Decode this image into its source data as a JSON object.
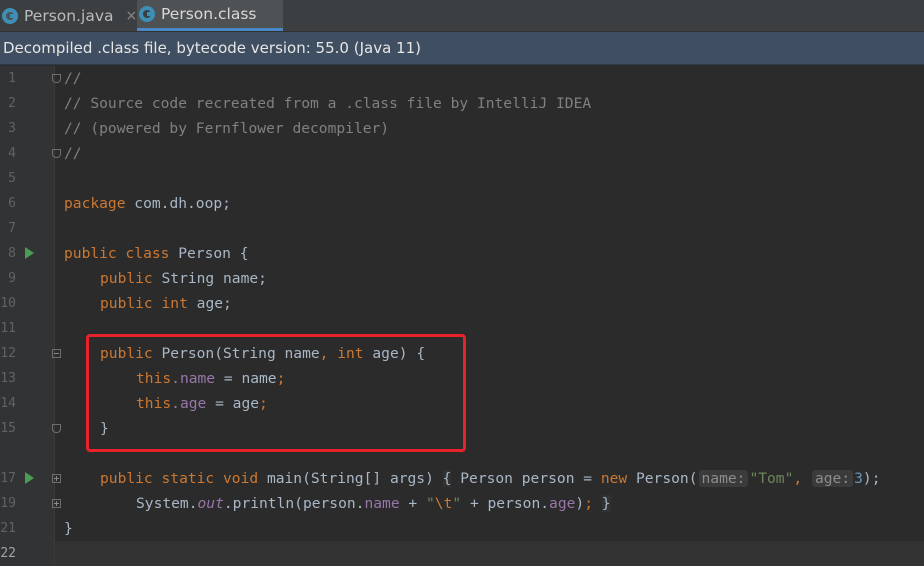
{
  "tabs": [
    {
      "label": "Person.java",
      "close": "×"
    },
    {
      "label": "Person.class"
    }
  ],
  "banner": "Decompiled .class file, bytecode version: 55.0 (Java 11)",
  "line_numbers": [
    "1",
    "2",
    "3",
    "4",
    "5",
    "6",
    "7",
    "8",
    "9",
    "10",
    "11",
    "12",
    "13",
    "14",
    "15",
    "17",
    "19",
    "21",
    "22"
  ],
  "code": {
    "l1": "//",
    "l2": "// Source code recreated from a .class file by IntelliJ IDEA",
    "l3": "// (powered by Fernflower decompiler)",
    "l4": "//",
    "l6_kw": "package",
    "l6_rest": " com.dh.oop;",
    "l8_kw": "public class",
    "l8_rest": " Person {",
    "l9_kw": "public",
    "l9_rest": " String name;",
    "l10_kw1": "public",
    "l10_kw2": " int",
    "l10_rest": " age;",
    "l12_kw": "public",
    "l12_a": " Person(String name",
    "l12_comma": ",",
    "l12_kw2": " int",
    "l12_b": " age) {",
    "l13_kw": "this",
    "l13_field": ".name",
    "l13_rest": " = name",
    "l13_semi": ";",
    "l14_kw": "this",
    "l14_field": ".age",
    "l14_rest": " = age",
    "l14_semi": ";",
    "l15": "}",
    "l17_kw": "public static void",
    "l17_a": " main(String[] args) ",
    "l17_brace": "{",
    "l17_b": " Person person = ",
    "l17_new": "new",
    "l17_c": " Person(",
    "l17_hint1": "name:",
    "l17_str": "\"Tom\"",
    "l17_comma": ",",
    "l17_hint2": "age:",
    "l17_num": "3",
    "l17_end": ");",
    "l19_a": "System.",
    "l19_out": "out",
    "l19_b": ".println(person.",
    "l19_name": "name",
    "l19_c": " + ",
    "l19_q1": "\"",
    "l19_esc": "\\t",
    "l19_q2": "\"",
    "l19_d": " + person.",
    "l19_age": "age",
    "l19_e": ")",
    "l19_semi": ";",
    "l19_brace": "}",
    "l21": "}"
  }
}
